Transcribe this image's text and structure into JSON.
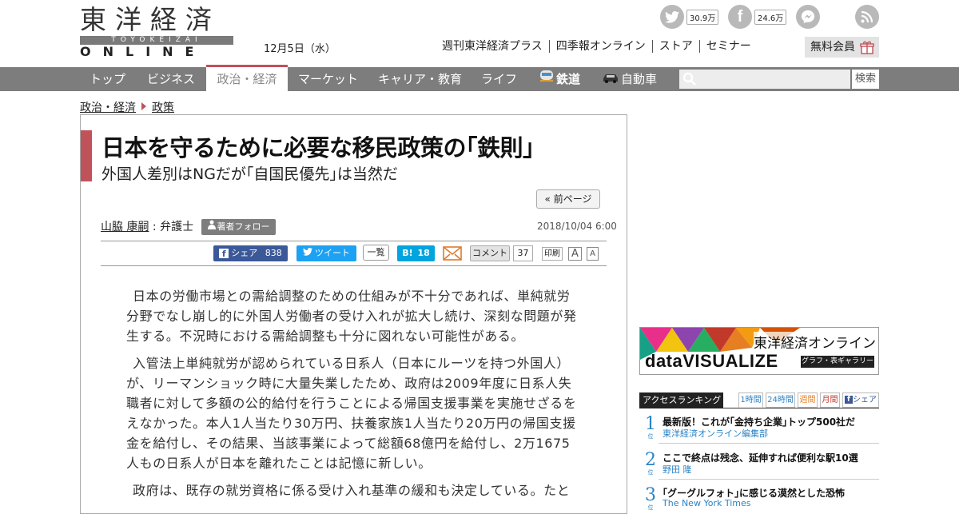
{
  "logo": {
    "kanji": "東洋経済",
    "sub": "TOYOKEIZAI",
    "online": "ONLINE"
  },
  "header": {
    "date": "12月5日（水）",
    "social": {
      "twitter_count": "30.9万",
      "facebook_count": "24.6万"
    },
    "links": [
      "週刊東洋経済プラス",
      "四季報オンライン",
      "ストア",
      "セミナー"
    ],
    "member_button": "無料会員"
  },
  "nav": {
    "items": [
      "トップ",
      "ビジネス",
      "政治・経済",
      "マーケット",
      "キャリア・教育",
      "ライフ",
      "鉄道",
      "自動車"
    ],
    "active": "政治・経済",
    "search_button": "検索"
  },
  "breadcrumb": [
    "政治・経済",
    "政策"
  ],
  "article": {
    "title": "日本を守るために必要な移民政策の｢鉄則｣",
    "subtitle": "外国人差別はNGだが｢自国民優先｣は当然だ",
    "prev_page": "« 前ページ",
    "author_name": "山脇 康嗣",
    "author_role": " : 弁護士",
    "follow": "著者フォロー",
    "date": "2018/10/04 6:00",
    "share": {
      "facebook": "シェア",
      "facebook_count": "838",
      "tweet": "ツイート",
      "list": "一覧",
      "hatena": "B!",
      "hatena_count": "18",
      "comment": "コメント",
      "comment_count": "37",
      "print": "印刷",
      "font_large": "A",
      "font_small": "A"
    },
    "paragraphs": [
      "日本の労働市場との需給調整のための仕組みが不十分であれば、単純就労分野でなし崩し的に外国人労働者の受け入れが拡大し続け、深刻な問題が発生する。不況時における需給調整も十分に図れない可能性がある。",
      "入管法上単純就労が認められている日系人（日本にルーツを持つ外国人）が、リーマンショック時に大量失業したため、政府は2009年度に日系人失職者に対して多額の公的給付を行うことによる帰国支援事業を実施せざるをえなかった。本人1人当たり30万円、扶養家族1人当たり20万円の帰国支援金を給付し、その結果、当該事業によって総額68億円を給付し、2万1675人もの日系人が日本を離れたことは記憶に新しい。",
      "政府は、既存の就労資格に係る受け入れ基準の緩和も決定している。たと"
    ]
  },
  "sidebar": {
    "dv_banner": {
      "title": "東洋経済オンライン",
      "logo": "dataVISUALIZE",
      "tag": "グラフ・表ギャラリー"
    },
    "ranking": {
      "heading": "アクセスランキング",
      "tabs": [
        "1時間",
        "24時間",
        "週間",
        "月間",
        "シェア"
      ],
      "rank_suffix": "位",
      "items": [
        {
          "rank": "1",
          "title": "最新版！これが｢金持ち企業｣トップ500社だ",
          "author": "東洋経済オンライン編集部"
        },
        {
          "rank": "2",
          "title": "ここで終点は残念、延伸すれば便利な駅10選",
          "author": "野田 隆"
        },
        {
          "rank": "3",
          "title": "｢グーグルフォト｣に感じる漠然とした恐怖",
          "author": "The New York Times"
        }
      ]
    }
  },
  "colors": {
    "accent": "#c0525a",
    "nav_bg": "#7d7d7d",
    "facebook": "#3b5998",
    "twitter": "#1da1f2",
    "hatena": "#00a4de",
    "link_blue": "#2b83c6"
  }
}
